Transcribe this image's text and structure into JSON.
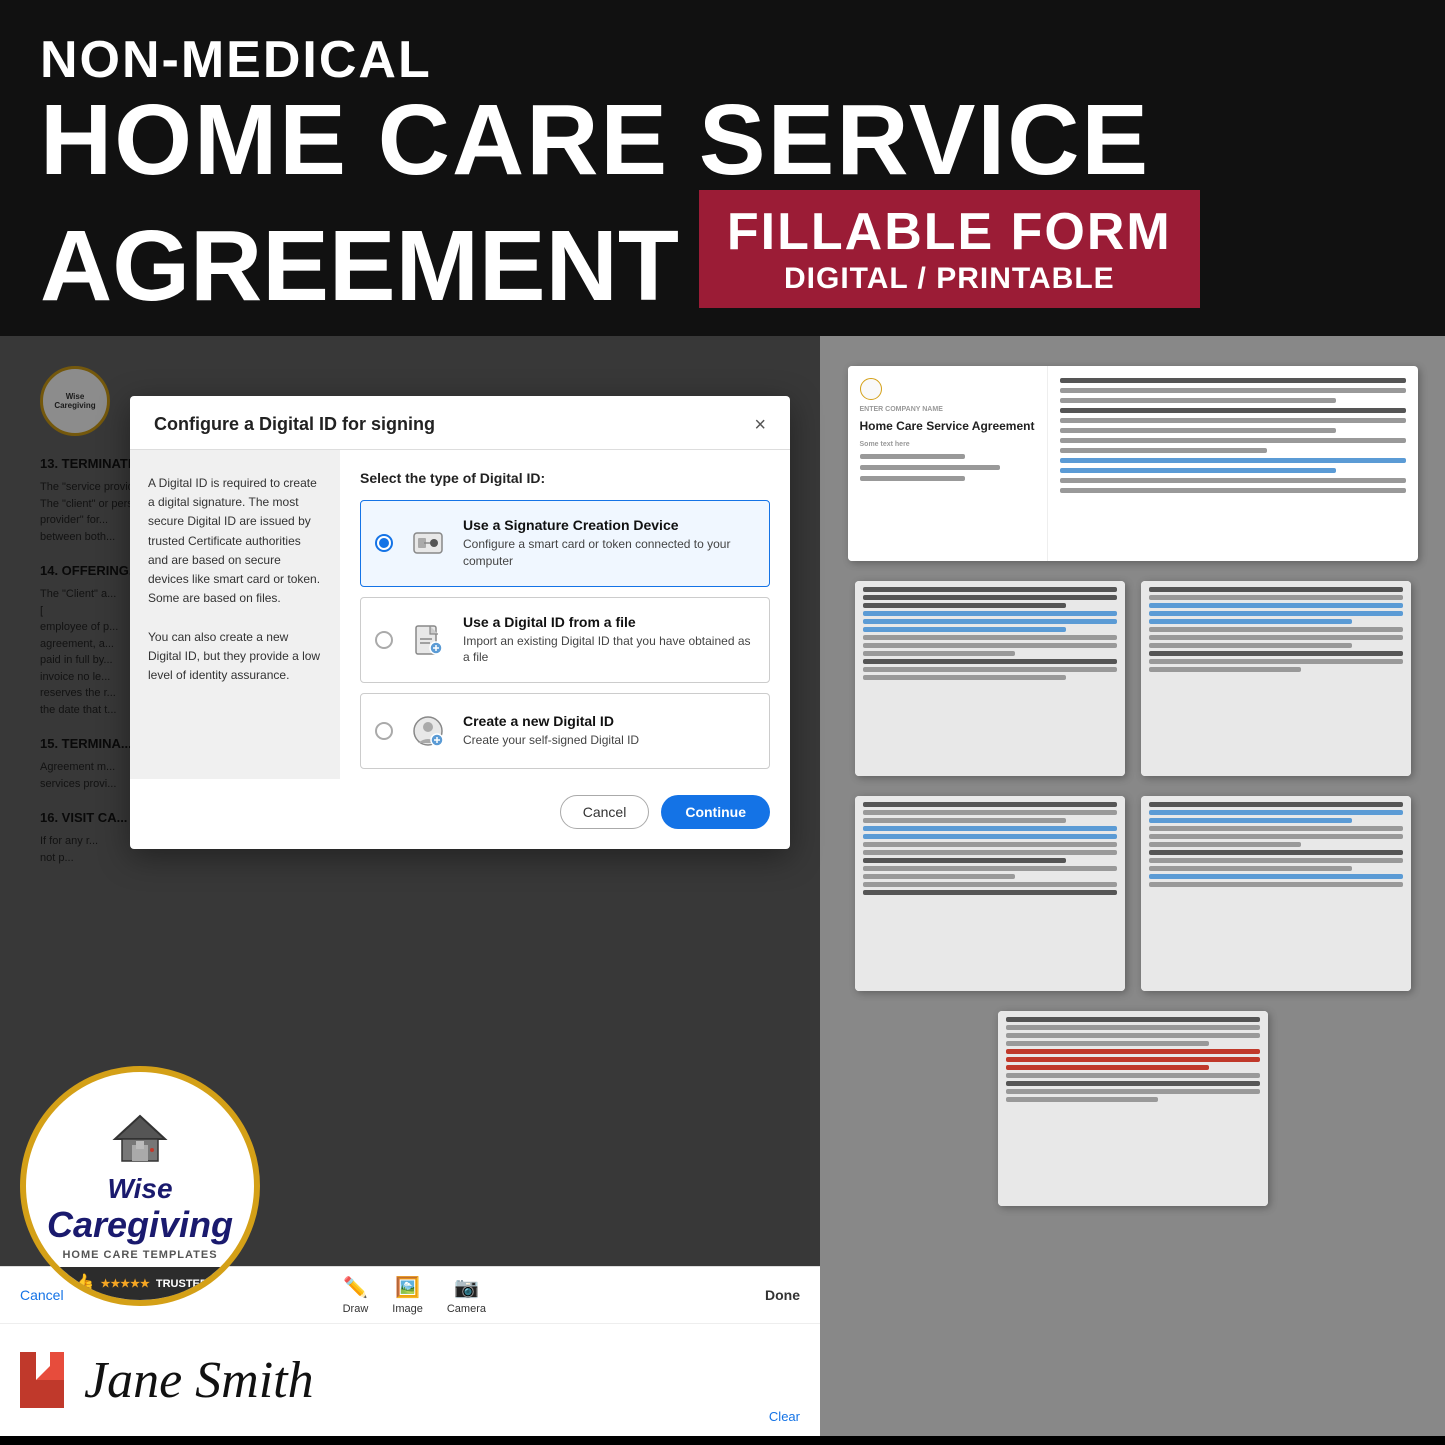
{
  "header": {
    "nonmedical": "NON-MEDICAL",
    "homecare": "HOME CARE SERVICE",
    "agreement": "AGREEMENT",
    "fillable": "FILLABLE FORM",
    "digital_printable": "DIGITAL / PRINTABLE"
  },
  "dialog": {
    "title": "Configure a Digital ID for signing",
    "close_label": "×",
    "left_panel_text": "A Digital ID is required to create a digital signature. The most secure Digital ID are issued by trusted Certificate authorities and are based on secure devices like smart card or token. Some are based on files.\n\nYou can also create a new Digital ID, but they provide a low level of identity assurance.",
    "select_label": "Select the type of Digital ID:",
    "options": [
      {
        "id": "signature-creation-device",
        "title": "Use a Signature Creation Device",
        "desc": "Configure a smart card or token connected to your computer",
        "selected": true,
        "icon": "🖊️"
      },
      {
        "id": "digital-id-from-file",
        "title": "Use a Digital ID from a file",
        "desc": "Import an existing Digital ID that you have obtained as a file",
        "selected": false,
        "icon": "📄"
      },
      {
        "id": "create-new-digital-id",
        "title": "Create a new Digital ID",
        "desc": "Create your self-signed Digital ID",
        "selected": false,
        "icon": "➕"
      }
    ],
    "cancel_label": "Cancel",
    "continue_label": "Continue"
  },
  "signature_strip": {
    "cancel_label": "Cancel",
    "draw_label": "Draw",
    "image_label": "Image",
    "camera_label": "Camera",
    "done_label": "Done",
    "clear_label": "Clear",
    "signature_text": "Jane Smith"
  },
  "logo": {
    "wise": "Wise",
    "caregiving": "Caregiving",
    "subtitle": "HOME CARE TEMPLATES",
    "trusted": "TRUSTED"
  },
  "colors": {
    "accent_blue": "#1473e6",
    "accent_red": "#9b1c36",
    "gold": "#d4a017",
    "dark": "#111111"
  }
}
